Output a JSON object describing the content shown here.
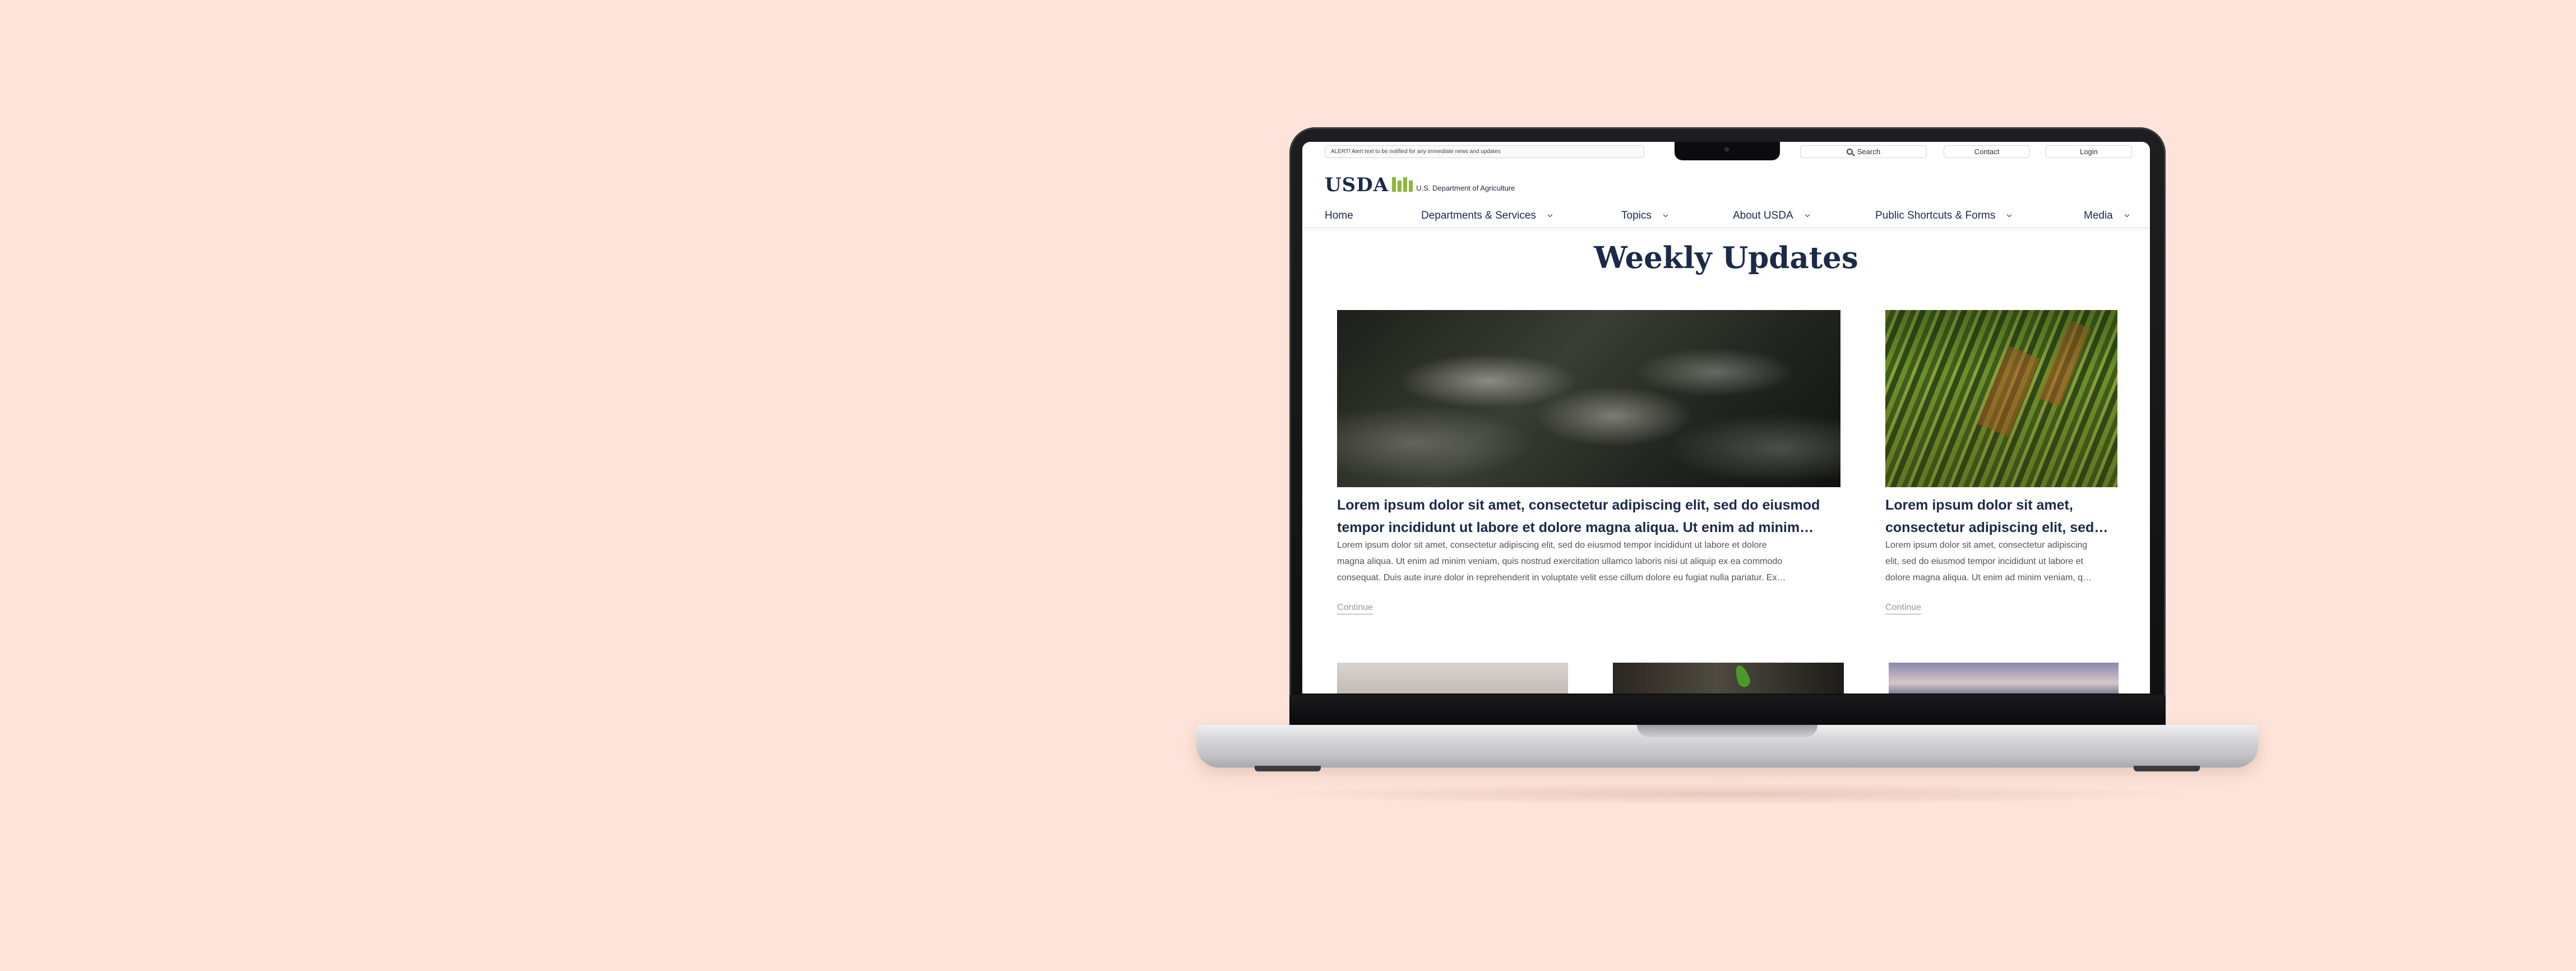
{
  "alert": "ALERT! Alert text to be notified for any immediate news and updates",
  "utility": {
    "search": "Search",
    "contact": "Contact",
    "login": "Login"
  },
  "logo": {
    "wordmark": "USDA",
    "subtitle": "U.S. Department of Agriculture"
  },
  "nav": [
    {
      "label": "Home"
    },
    {
      "label": "Departments & Services"
    },
    {
      "label": "Topics"
    },
    {
      "label": "About USDA"
    },
    {
      "label": "Public Shortcuts & Forms"
    },
    {
      "label": "Media"
    }
  ],
  "page_title": "Weekly Updates",
  "cards": [
    {
      "title_line1": "Lorem ipsum dolor sit amet, consectetur adipiscing elit, sed do eiusmod",
      "title_line2": "tempor incididunt ut labore et dolore magna aliqua. Ut enim ad minim…",
      "text_line1": "Lorem ipsum dolor sit amet, consectetur adipiscing elit, sed do eiusmod tempor incididunt ut labore et dolore",
      "text_line2": "magna aliqua. Ut enim ad minim veniam, quis nostrud exercitation ullamco laboris nisi ut aliquip ex ea commodo",
      "text_line3": "consequat. Duis aute irure dolor in reprehenderit in voluptate velit esse cillum dolore eu fugiat nulla pariatur. Ex…",
      "link": "Continue"
    },
    {
      "title_line1": "Lorem ipsum dolor sit amet,",
      "title_line2": "consectetur adipiscing elit, sed…",
      "text_line1": "Lorem ipsum dolor sit amet, consectetur adipiscing",
      "text_line2": "elit, sed do eiusmod tempor incididunt ut labore et",
      "text_line3": "dolore magna aliqua. Ut enim ad minim veniam, q…",
      "link": "Continue"
    }
  ],
  "icons": {
    "search": "search-icon",
    "nav_chevron": "chevron-down-icon"
  },
  "colors": {
    "background": "#fde3d9",
    "brand_navy": "#1b2a4a",
    "brand_green": "#8cb63c"
  }
}
